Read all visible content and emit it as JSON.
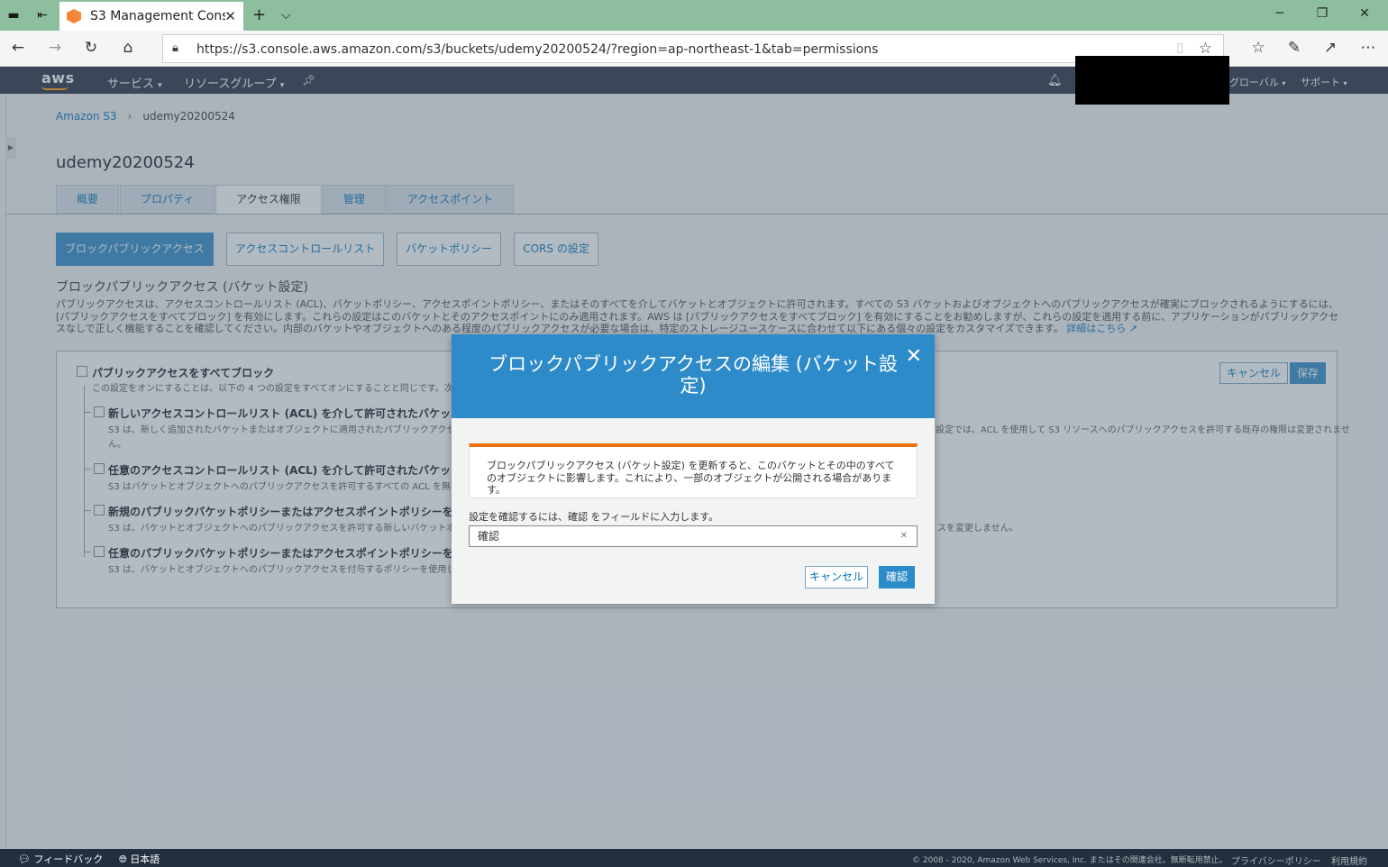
{
  "browser": {
    "tab_title": "S3 Management Conso",
    "url": "https://s3.console.aws.amazon.com/s3/buckets/udemy20200524/?region=ap-northeast-1&tab=permissions"
  },
  "aws_header": {
    "logo": "aws",
    "services": "サービス",
    "resource_groups": "リソースグループ",
    "region": "グローバル",
    "support": "サポート"
  },
  "breadcrumb": {
    "root": "Amazon S3",
    "separator": "›",
    "current": "udemy20200524"
  },
  "bucket_name": "udemy20200524",
  "tabs": [
    {
      "label": "概要"
    },
    {
      "label": "プロパティ"
    },
    {
      "label": "アクセス権限"
    },
    {
      "label": "管理"
    },
    {
      "label": "アクセスポイント"
    }
  ],
  "active_tab": "アクセス権限",
  "subtabs": [
    {
      "label": "ブロックパブリックアクセス"
    },
    {
      "label": "アクセスコントロールリスト"
    },
    {
      "label": "バケットポリシー"
    },
    {
      "label": "CORS の設定"
    }
  ],
  "section": {
    "title": "ブロックパブリックアクセス (バケット設定)",
    "description": "パブリックアクセスは、アクセスコントロールリスト (ACL)、バケットポリシー、アクセスポイントポリシー、またはそのすべてを介してバケットとオブジェクトに許可されます。すべての S3 バケットおよびオブジェクトへのパブリックアクセスが確実にブロックされるようにするには、[パブリックアクセスをすべてブロック] を有効にします。これらの設定はこのバケットとそのアクセスポイントにのみ適用されます。AWS は [パブリックアクセスをすべてブロック] を有効にすることをお勧めしますが、これらの設定を適用する前に、アプリケーションがパブリックアクセスなしで正しく機能することを確認してください。内部のバケットやオブジェクトへのある程度のパブリックアクセスが必要な場合は、特定のストレージユースケースに合わせて以下にある個々の設定をカスタマイズできます。",
    "more_link": "詳細はこちら"
  },
  "panel": {
    "cancel": "キャンセル",
    "save": "保存",
    "block_all_title": "パブリックアクセスをすべてブロック",
    "block_all_desc": "この設定をオンにすることは、以下の 4 つの設定をすべてオンにすることと同じです。次の各設",
    "options": [
      {
        "title": "新しいアクセスコントロールリスト (ACL) を介して許可されたバケットとオブ",
        "desc": "S3 は、新しく追加されたバケットまたはオブジェクトに適用されたパブリックアクセス許可",
        "desc2": "ん。",
        "desc_right": "設定では、ACL を使用して S3 リソースへのパブリックアクセスを許可する既存の権限は変更されませ"
      },
      {
        "title": "任意のアクセスコントロールリスト (ACL) を介して許可されたバケットとオブ",
        "desc": "S3 はバケットとオブジェクトへのパブリックアクセスを許可するすべての ACL を無視しま"
      },
      {
        "title": "新規のパブリックバケットポリシーまたはアクセスポイントポリシーを介して",
        "desc": "S3 は、バケットとオブジェクトへのパブリックアクセスを許可する新しいバケットポリシー",
        "desc_right": "スを変更しません。"
      },
      {
        "title": "任意のパブリックバケットポリシーまたはアクセスポイントポリシーを介したバ",
        "desc": "S3 は、バケットとオブジェクトへのパブリックアクセスを付与するポリシーを使用したバケ"
      }
    ]
  },
  "modal": {
    "title": "ブロックパブリックアクセスの編集 (バケット設定)",
    "warning": "ブロックパブリックアクセス (バケット設定) を更新すると、このバケットとその中のすべてのオブジェクトに影響します。これにより、一部のオブジェクトが公開される場合があります。",
    "confirm_instruction": "設定を確認するには、確認 をフィールドに入力します。",
    "confirm_value": "確認",
    "cancel": "キャンセル",
    "confirm": "確認"
  },
  "footer": {
    "feedback": "フィードバック",
    "language": "日本語",
    "copyright": "© 2008 - 2020, Amazon Web Services, Inc. またはその関連会社。無断転用禁止。",
    "privacy": "プライバシーポリシー",
    "terms": "利用規約"
  },
  "colors": {
    "aws_nav": "#232f3e",
    "aws_orange": "#ff9900",
    "primary_blue": "#2e8bc9",
    "link_blue": "#0073bb",
    "warning_orange": "#ec7211",
    "window_titlebar": "#8dbf9e"
  }
}
